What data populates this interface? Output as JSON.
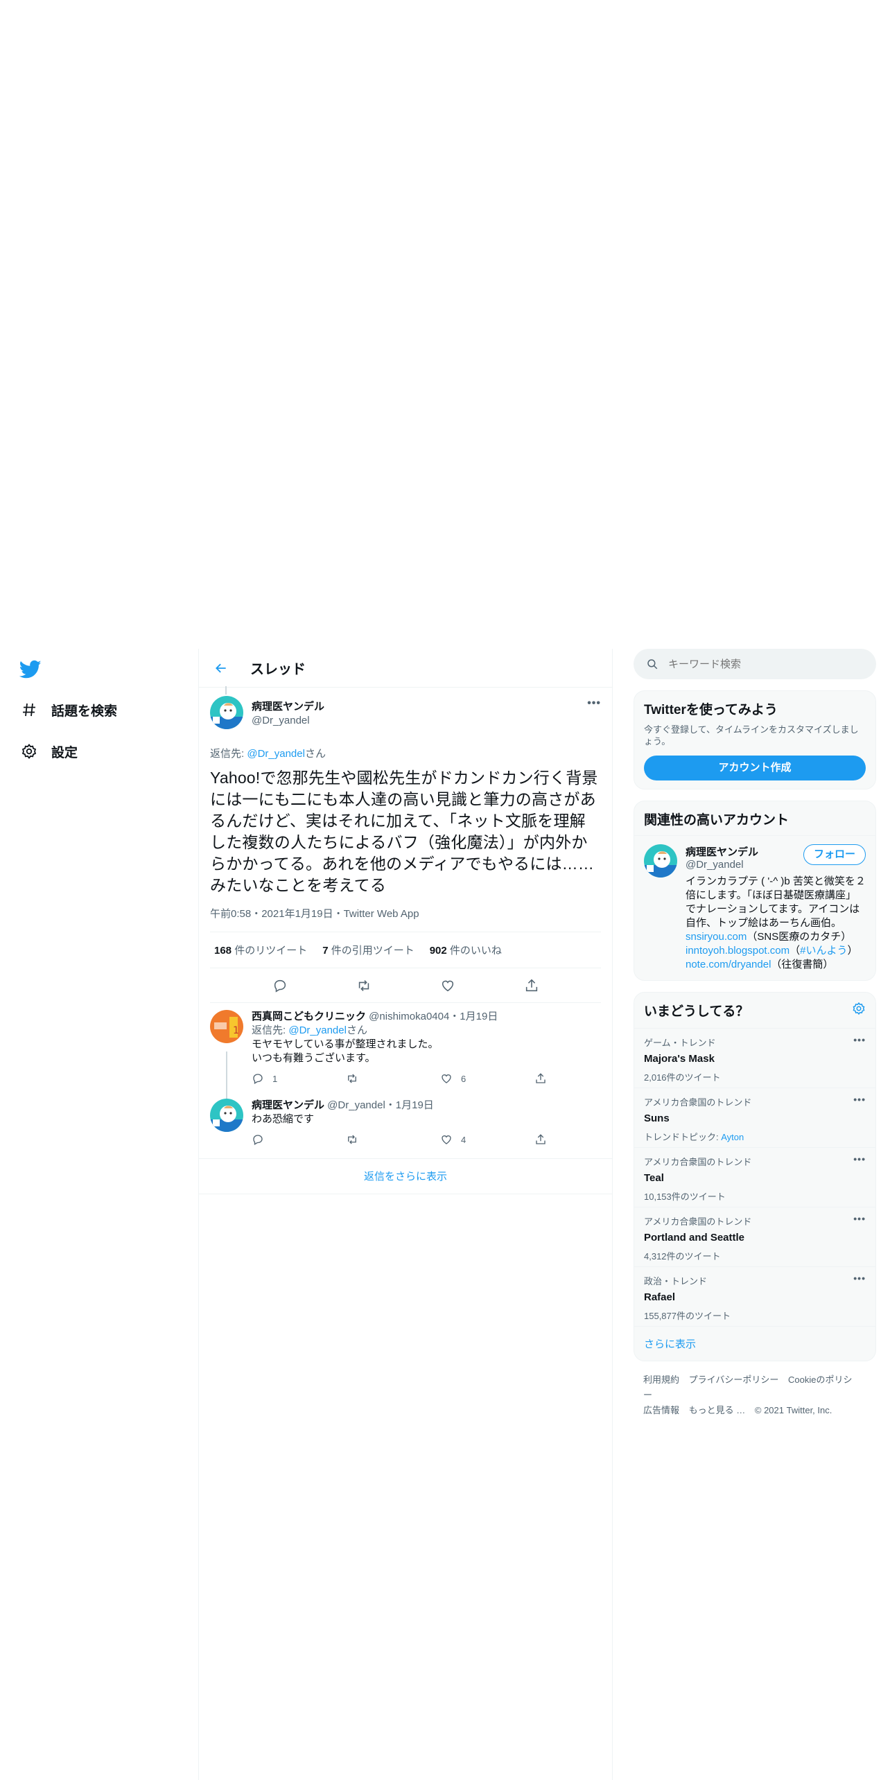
{
  "nav": {
    "items": [
      {
        "label": "話題を検索"
      },
      {
        "label": "設定"
      }
    ]
  },
  "header": {
    "title": "スレッド"
  },
  "main_tweet": {
    "author_name": "病理医ヤンデル",
    "author_handle": "@Dr_yandel",
    "reply_prefix": "返信先: ",
    "reply_mention": "@Dr_yandel",
    "reply_suffix": "さん",
    "text": "Yahoo!で忽那先生や國松先生がドカンドカン行く背景には一にも二にも本人達の高い見識と筆力の高さがあるんだけど、実はそれに加えて、「ネット文脈を理解した複数の人たちによるバフ（強化魔法）」が内外からかかってる。あれを他のメディアでもやるには……みたいなことを考えてる",
    "meta": "午前0:58・2021年1月19日・Twitter Web App",
    "retweets": "168",
    "retweets_label": " 件のリツイート",
    "quotes": "7",
    "quotes_label": " 件の引用ツイート",
    "likes": "902",
    "likes_label": " 件のいいね"
  },
  "replies": [
    {
      "name": "西真岡こどもクリニック",
      "handle": " @nishimoka0404・1月19日",
      "reply_prefix": "返信先: ",
      "reply_mention": "@Dr_yandel",
      "reply_suffix": "さん",
      "line1": "モヤモヤしている事が整理されました。",
      "line2": "いつも有難うございます。",
      "reply_count": "1",
      "retweet_count": "",
      "like_count": "6"
    },
    {
      "name": "病理医ヤンデル",
      "handle": " @Dr_yandel・1月19日",
      "line1": "わあ恐縮です",
      "reply_count": "",
      "retweet_count": "",
      "like_count": "4"
    }
  ],
  "show_more_replies": "返信をさらに表示",
  "search": {
    "placeholder": "キーワード検索"
  },
  "signup": {
    "title": "Twitterを使ってみよう",
    "subtitle": "今すぐ登録して、タイムラインをカスタマイズしましょう。",
    "button": "アカウント作成"
  },
  "related": {
    "title": "関連性の高いアカウント",
    "name": "病理医ヤンデル",
    "handle": "@Dr_yandel",
    "follow": "フォロー",
    "bio1": "イランカラプテ ( '-^ )b 苦笑と微笑を２倍にします。「ほぼ日基礎医療講座」でナレーションしてます。アイコンは自作、トップ絵はあーちん画伯。",
    "link1": "snsiryou.com",
    "bio2": "（SNS医療のカタチ）",
    "link2": "inntoyoh.blogspot.com",
    "bio3": "（",
    "link3": "#いんよう",
    "bio4": "）",
    "link4": "note.com/dryandel",
    "bio5": "（往復書簡）"
  },
  "trends": {
    "title": "いまどうしてる？",
    "items": [
      {
        "context": "ゲーム・トレンド",
        "name": "Majora's Mask",
        "count": "2,016件のツイート"
      },
      {
        "context": "アメリカ合衆国のトレンド",
        "name": "Suns",
        "count": "トレンドトピック: ",
        "count_link": "Ayton"
      },
      {
        "context": "アメリカ合衆国のトレンド",
        "name": "Teal",
        "count": "10,153件のツイート"
      },
      {
        "context": "アメリカ合衆国のトレンド",
        "name": "Portland and Seattle",
        "count": "4,312件のツイート"
      },
      {
        "context": "政治・トレンド",
        "name": "Rafael",
        "count": "155,877件のツイート"
      }
    ],
    "show_more": "さらに表示"
  },
  "footer": {
    "terms": "利用規約",
    "privacy": "プライバシーポリシー",
    "cookie": "Cookieのポリシー",
    "ads": "広告情報",
    "more": "もっと見る …",
    "copyright": "© 2021 Twitter, Inc."
  },
  "colors": {
    "accent": "#1d9bf0",
    "text": "#0f1419",
    "muted": "#536471",
    "border": "#eff3f4"
  }
}
